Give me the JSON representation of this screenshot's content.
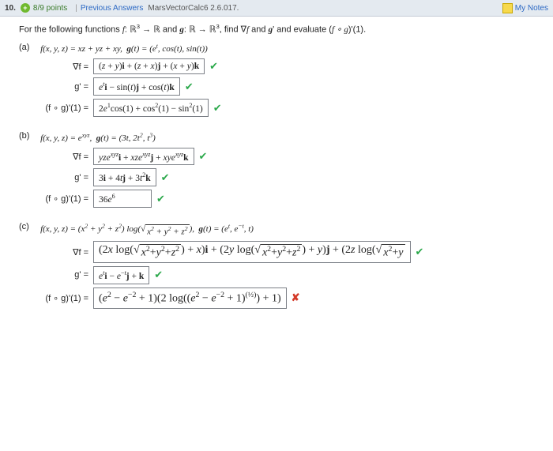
{
  "header": {
    "qnum": "10.",
    "points": "8/9 points",
    "prev_link": "Previous Answers",
    "code": "MarsVectorCalc6 2.6.017.",
    "my_notes": "My Notes"
  },
  "prompt_segments": {
    "s1": "For the following functions ",
    "s2": "f",
    "s3": ": ℝ",
    "s4": "3",
    "s5": " → ℝ and ",
    "s6": "g",
    "s7": ": ℝ → ℝ",
    "s8": "3",
    "s9": ", find ∇",
    "s10": "f",
    "s11": " and ",
    "s12": "g",
    "s13": "' and evaluate (",
    "s14": "f ∘ g",
    "s15": ")'(1)."
  },
  "a": {
    "label": "(a)",
    "stmt": "f(x, y, z) = xz + yz + xy,  g(t) = (eᵗ, cos(t), sin(t))",
    "grad_lbl": "∇f  =",
    "grad": "(z + y)i + (z + x)j + (x + y)k",
    "gp_lbl": "g'  =",
    "gp": "eᵗi − sin(t)j + cos(t)k",
    "comp_lbl": "(f ∘ g)'(1)  =",
    "comp": "2e¹cos(1) + cos²(1) − sin²(1)"
  },
  "b": {
    "label": "(b)",
    "stmt_pre": "f(x, y, z) = e",
    "stmt_exp": "xyz",
    "stmt_mid": ", g(t) = (3t, 2t², t³)",
    "grad_lbl": "∇f  =",
    "grad": "yze^(xyz)i + xze^(xyz)j + xye^(xyz)k",
    "gp_lbl": "g'  =",
    "gp": "3i + 4tj + 3t²k",
    "comp_lbl": "(f ∘ g)'(1)  =",
    "comp": "36e⁶"
  },
  "c": {
    "label": "(c)",
    "stmt_pre": "f(x, y, z) = (x² + y² + z²) log(",
    "stmt_sqrt": "x² + y² + z²",
    "stmt_post": "),  g(t) = (eᵗ, e⁻ᵗ, t)",
    "grad_lbl": "∇f  =",
    "grad": "(2x log(√(x²+y²+z²)) + x)i + (2y log(√(x²+y²+z²)) + y)j + (2z log(√(x²+y",
    "gp_lbl": "g'  =",
    "gp": "eᵗi − e⁻ᵗj + k",
    "comp_lbl": "(f ∘ g)'(1)  =",
    "comp": "(e² − e⁻² + 1)(2 log((e² − e⁻² + 1)^(½)) + 1)"
  },
  "marks": {
    "ok": "✔",
    "bad": "✘"
  },
  "chart_data": null
}
